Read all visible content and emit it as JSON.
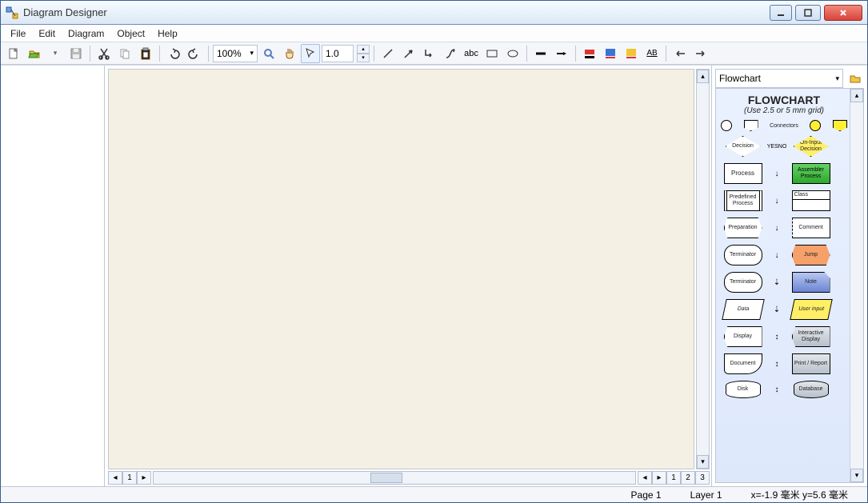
{
  "window": {
    "title": "Diagram Designer"
  },
  "menu": {
    "file": "File",
    "edit": "Edit",
    "diagram": "Diagram",
    "object": "Object",
    "help": "Help"
  },
  "toolbar": {
    "zoom": "100%",
    "linewidth": "1.0",
    "text_tool": "abc",
    "underline": "AB"
  },
  "palette": {
    "dropdown": "Flowchart",
    "title": "FLOWCHART",
    "subtitle": "(Use 2.5 or 5 mm grid)",
    "connectors_label": "Connectors",
    "yes": "YES",
    "no": "NO",
    "shapes": {
      "decision": "Decision",
      "on_input": "On-Input Decision",
      "process": "Process",
      "assembler": "Assembler Process",
      "predef": "Predefined Process",
      "class": "Class",
      "preparation": "Preparation",
      "comment": "Comment",
      "terminator1": "Terminator",
      "jump": "Jump",
      "terminator2": "Terminator",
      "note": "Note",
      "data": "Data",
      "user_input": "User input",
      "display": "Display",
      "interactive": "Interactive Display",
      "document": "Document",
      "print": "Print / Report",
      "disk": "Disk",
      "database": "Database"
    }
  },
  "status": {
    "page": "Page 1",
    "layer": "Layer 1",
    "coords": "x=-1.9 毫米  y=5.6 毫米"
  },
  "tabs": {
    "t1": "1",
    "t2": "2",
    "t3": "3",
    "p1": "1"
  }
}
